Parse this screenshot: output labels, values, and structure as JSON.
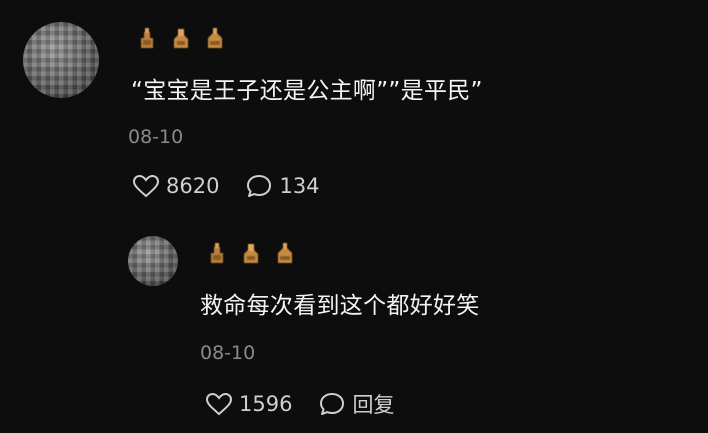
{
  "comment": {
    "text": "“宝宝是王子还是公主啊””是平民”",
    "date": "08-10",
    "likes": "8620",
    "replies": "134"
  },
  "reply": {
    "text": "救命每次看到这个都好好笑",
    "date": "08-10",
    "likes": "1596",
    "reply_label": "回复"
  },
  "colors": {
    "background": "#0d0d0d",
    "text": "#f4f4f4",
    "muted": "#8a8a8a",
    "badge": "#c98a3c"
  },
  "icons": [
    "heart-icon",
    "comment-bubble-icon"
  ]
}
